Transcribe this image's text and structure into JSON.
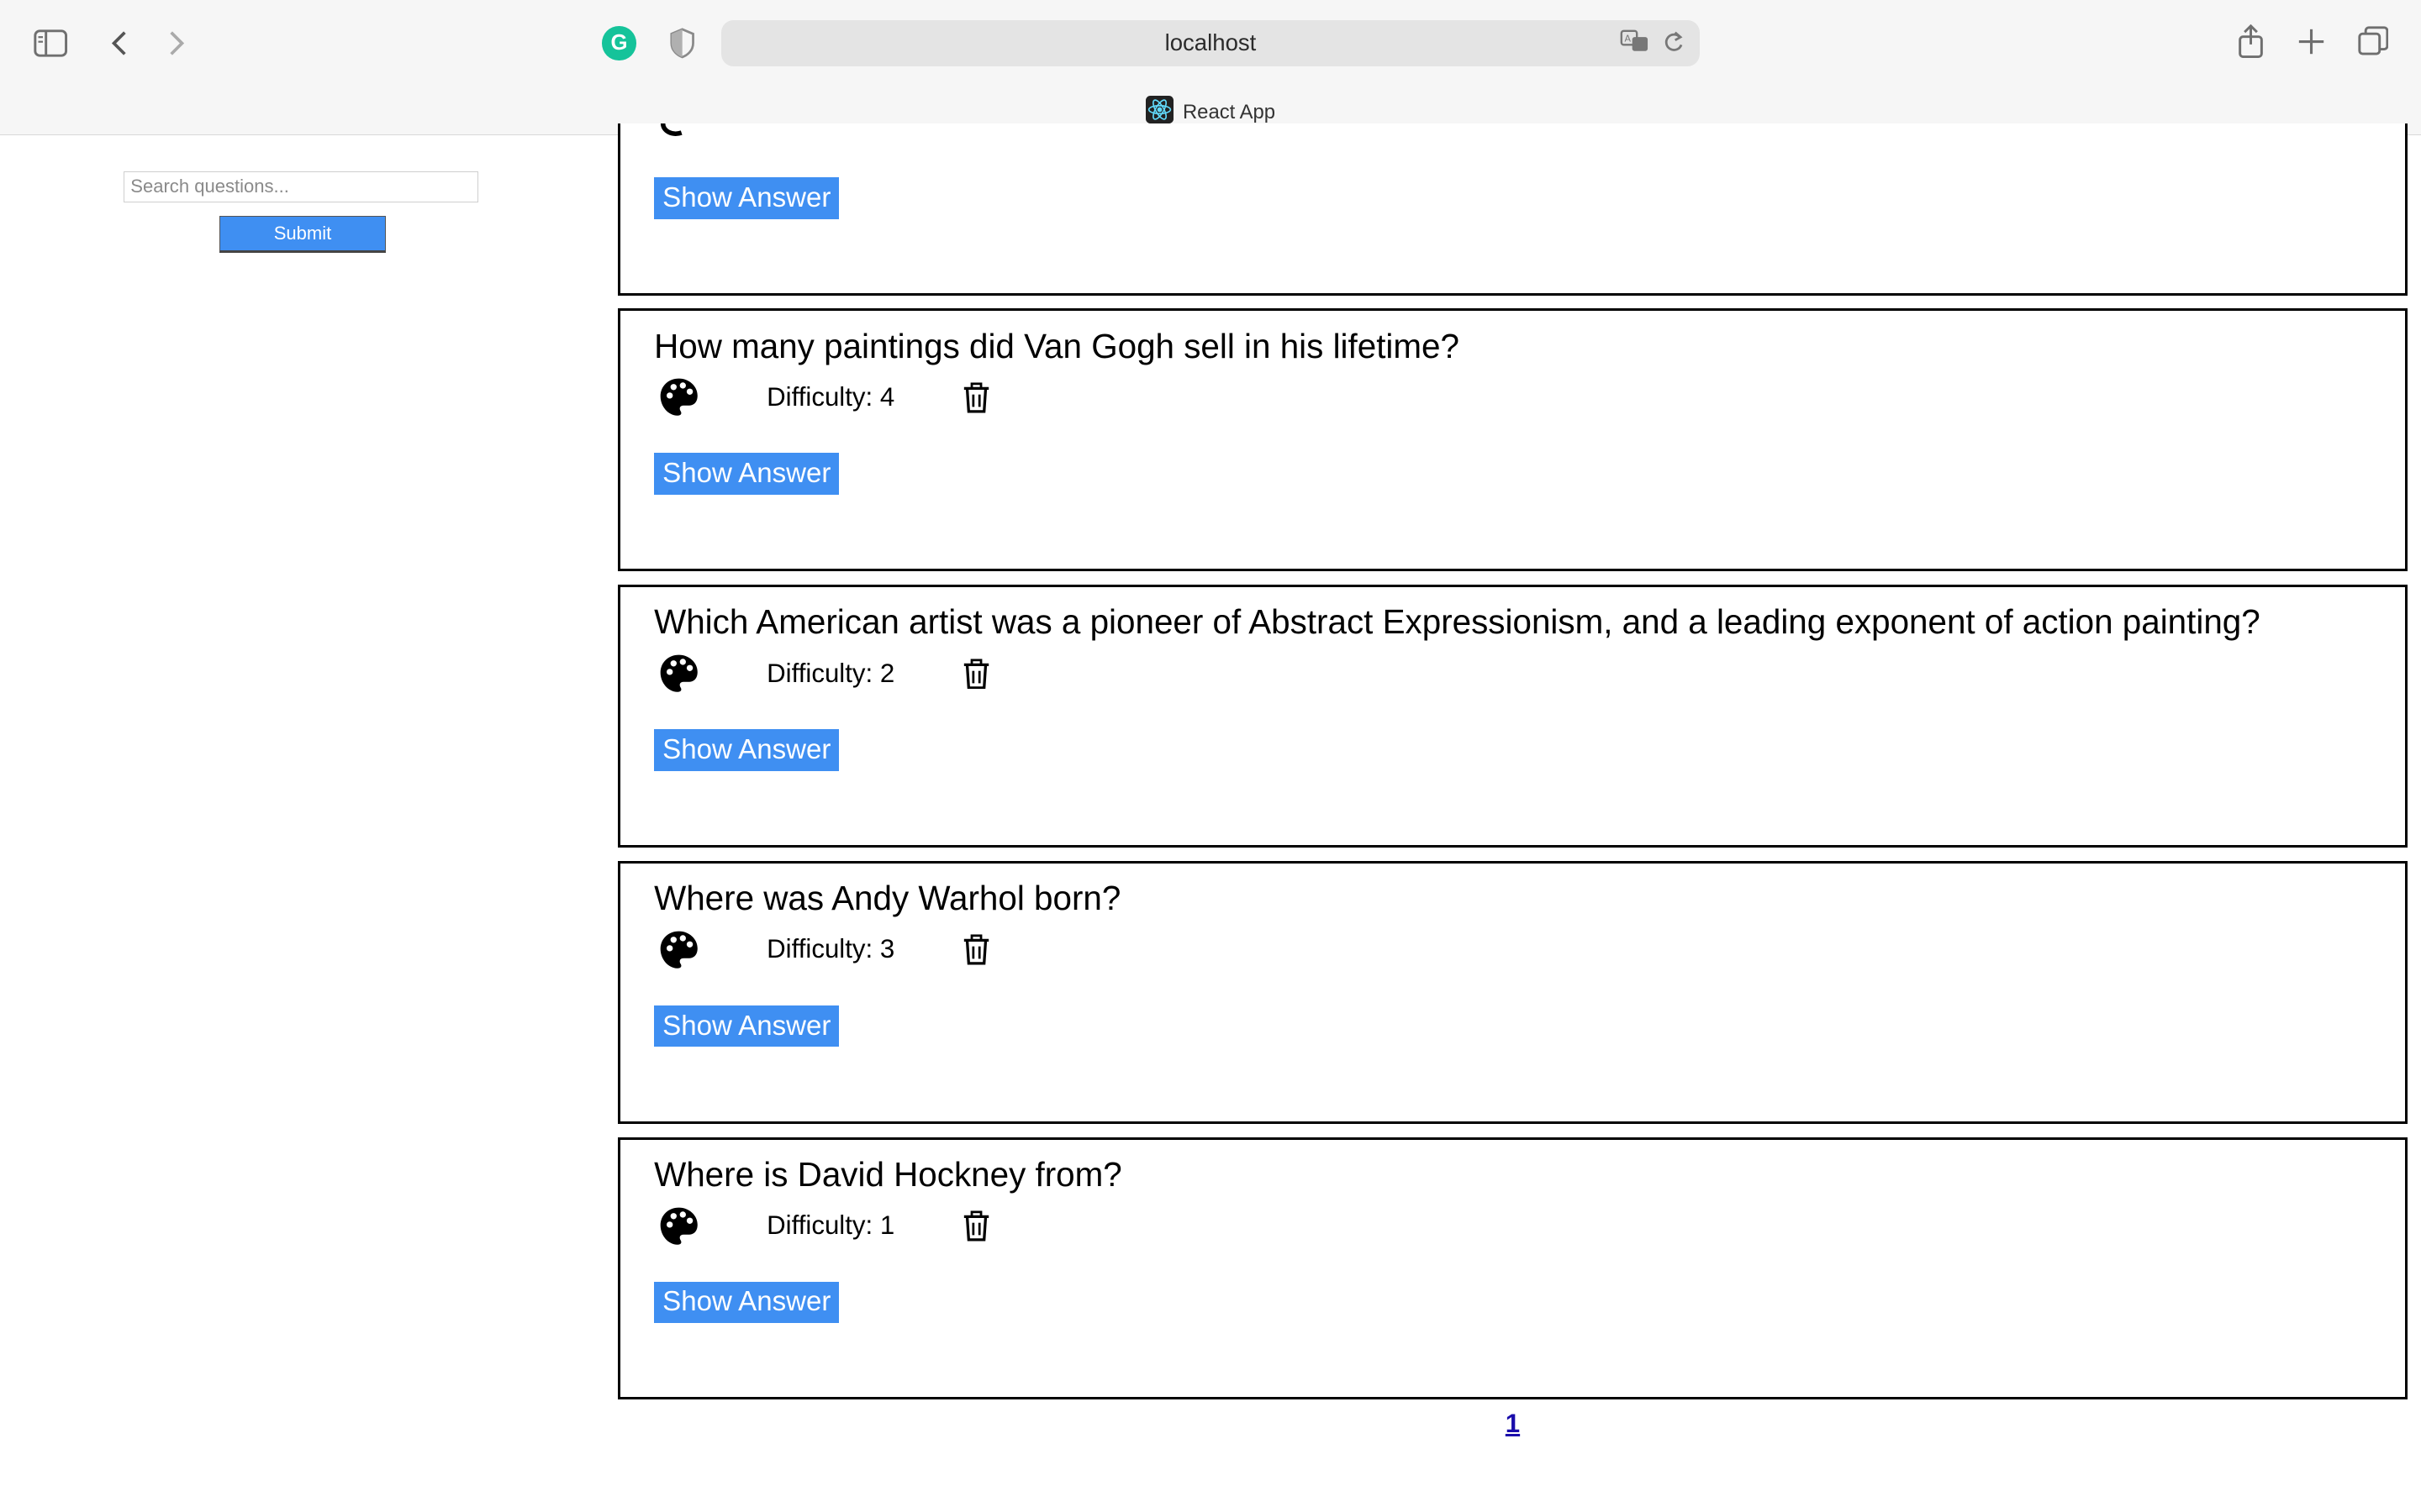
{
  "browser": {
    "url": "localhost",
    "tab_title": "React App"
  },
  "sidebar": {
    "search_placeholder": "Search questions...",
    "submit_label": "Submit"
  },
  "questions": [
    {
      "question": "",
      "difficulty": "",
      "show_label": "Show Answer"
    },
    {
      "question": "How many paintings did Van Gogh sell in his lifetime?",
      "difficulty": "Difficulty: 4",
      "show_label": "Show Answer"
    },
    {
      "question": "Which American artist was a pioneer of Abstract Expressionism, and a leading exponent of action painting?",
      "difficulty": "Difficulty: 2",
      "show_label": "Show Answer"
    },
    {
      "question": "Where was Andy Warhol born?",
      "difficulty": "Difficulty: 3",
      "show_label": "Show Answer"
    },
    {
      "question": "Where is David Hockney from?",
      "difficulty": "Difficulty: 1",
      "show_label": "Show Answer"
    }
  ],
  "pagination": {
    "current_page": "1"
  },
  "icons": {
    "category": "palette-icon",
    "delete": "trash-icon"
  },
  "colors": {
    "button_blue": "#3f8ff2",
    "link_blue": "#1a0dab"
  }
}
